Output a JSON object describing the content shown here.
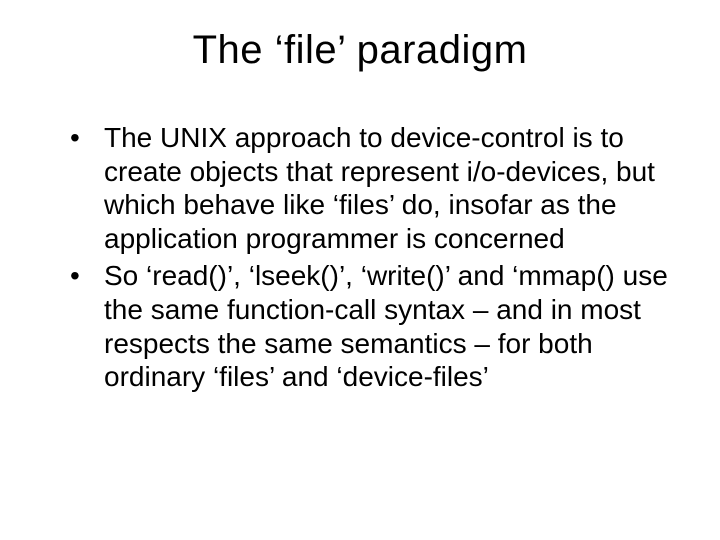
{
  "slide": {
    "title": "The ‘file’ paradigm",
    "bullets": [
      "The UNIX approach to device-control is to create objects that represent i/o-devices, but which behave like ‘files’ do, insofar as the application programmer is concerned",
      "So ‘read()’, ‘lseek()’, ‘write()’ and ‘mmap() use the same function-call syntax – and in most respects the same semantics – for both ordinary ‘files’ and ‘device-files’"
    ]
  }
}
